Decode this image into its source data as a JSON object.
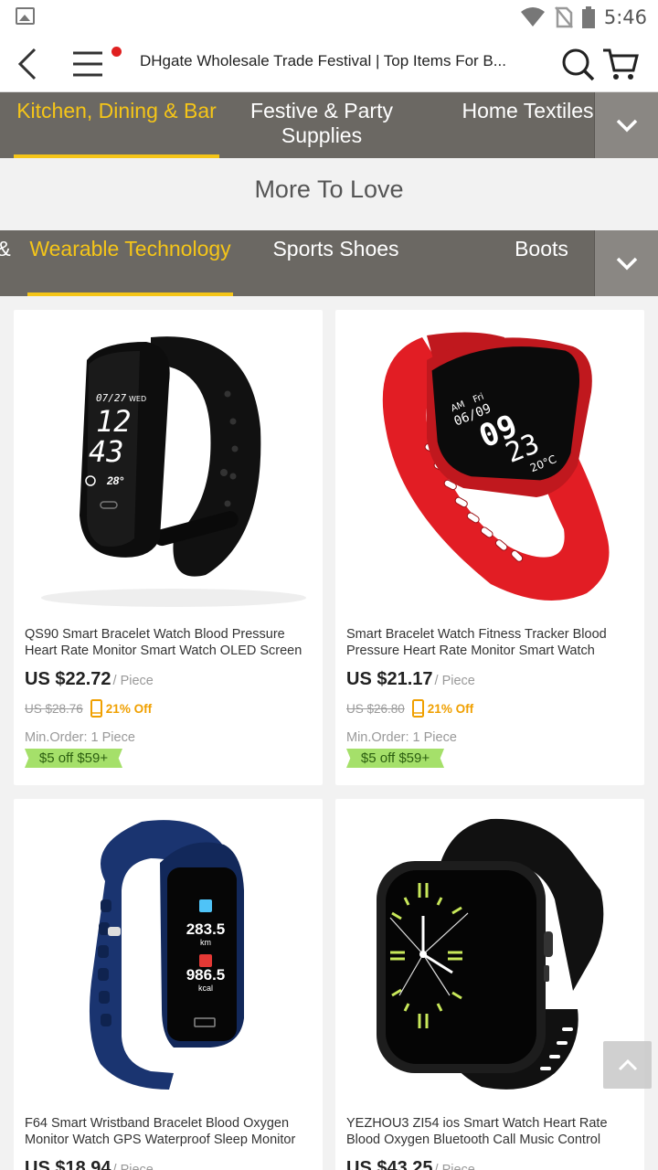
{
  "status_bar": {
    "time": "5:46"
  },
  "topnav": {
    "title": "DHgate Wholesale Trade Festival | Top Items For B..."
  },
  "category_tabs": [
    {
      "label": "Kitchen, Dining & Bar"
    },
    {
      "label": "Festive & Party Supplies"
    },
    {
      "label": "Home Textiles"
    }
  ],
  "section_title": "More To Love",
  "sub_tabs": [
    {
      "label": "&"
    },
    {
      "label": "Wearable Technology"
    },
    {
      "label": "Sports Shoes"
    },
    {
      "label": "Boots"
    }
  ],
  "products": [
    {
      "name": "QS90 Smart Bracelet Watch Blood Pressure Heart Rate Monitor Smart Watch OLED Screen Fitness Tracker",
      "price": "US $22.72",
      "unit": "/ Piece",
      "original_price": "US $28.76",
      "discount": "21% Off",
      "min_order": "Min.Order: 1 Piece",
      "coupon": "$5 off $59+",
      "screen": {
        "date": "07/27",
        "day": "WED",
        "hour": "12",
        "minute": "43",
        "temp": "28°"
      }
    },
    {
      "name": "Smart Bracelet Watch Fitness Tracker Blood Pressure Heart Rate Monitor Smart Watch Waterproof",
      "price": "US $21.17",
      "unit": "/ Piece",
      "original_price": "US $26.80",
      "discount": "21% Off",
      "min_order": "Min.Order: 1 Piece",
      "coupon": "$5 off $59+",
      "screen": {
        "ampm": "AM",
        "date": "06/09",
        "day": "Fri",
        "hour": "09",
        "minute": "23",
        "temp": "20°C"
      }
    },
    {
      "name": "F64 Smart Wristband Bracelet Blood Oxygen Monitor Watch GPS Waterproof Sleep Monitor Fitness",
      "price": "US $18.94",
      "unit": "/ Piece",
      "screen": {
        "distance": "283.5",
        "distance_unit": "km",
        "calories": "986.5",
        "calories_unit": "kcal"
      }
    },
    {
      "name": "YEZHOU3 ZI54 ios Smart Watch Heart Rate Blood Oxygen Bluetooth Call Music Control Smart Watch",
      "price": "US $43.25",
      "unit": "/ Piece"
    }
  ],
  "colors": {
    "accent": "#f5c518",
    "tab_bar": "#6b6863",
    "coupon": "#a5e06a",
    "discount": "#f0a000"
  }
}
